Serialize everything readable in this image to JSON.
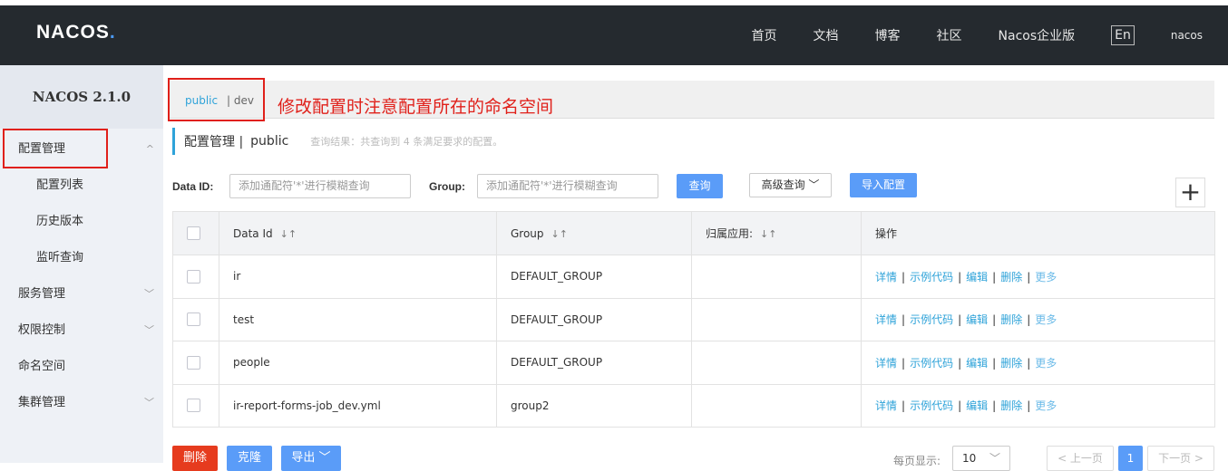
{
  "header": {
    "logo": "NACOS",
    "logo_dot": ".",
    "nav": [
      "首页",
      "文档",
      "博客",
      "社区",
      "Nacos企业版"
    ],
    "lang": "En",
    "user": "nacos"
  },
  "sidebar": {
    "version": "NACOS 2.1.0",
    "items": [
      {
        "label": "配置管理",
        "arrow": "^"
      },
      {
        "label": "配置列表"
      },
      {
        "label": "历史版本"
      },
      {
        "label": "监听查询"
      },
      {
        "label": "服务管理",
        "arrow": "﹀"
      },
      {
        "label": "权限控制",
        "arrow": "﹀"
      },
      {
        "label": "命名空间"
      },
      {
        "label": "集群管理",
        "arrow": "﹀"
      }
    ]
  },
  "namespace": {
    "public": "public",
    "dev": "| dev"
  },
  "annotation": "修改配置时注意配置所在的命名空间",
  "title": {
    "main": "配置管理 |",
    "ns": "public",
    "result": "查询结果：共查询到 4 条满足要求的配置。"
  },
  "filters": {
    "dataid_label": "Data ID:",
    "dataid_placeholder": "添加通配符'*'进行模糊查询",
    "group_label": "Group:",
    "group_placeholder": "添加通配符'*'进行模糊查询",
    "query": "查询",
    "advanced": "高级查询 ﹀",
    "import": "导入配置",
    "plus": "+"
  },
  "table": {
    "headers": [
      "Data Id",
      "Group",
      "归属应用:",
      "操作"
    ],
    "sort_icon": "↓↑",
    "rows": [
      {
        "dataid": "ir",
        "group": "DEFAULT_GROUP",
        "app": ""
      },
      {
        "dataid": "test",
        "group": "DEFAULT_GROUP",
        "app": ""
      },
      {
        "dataid": "people",
        "group": "DEFAULT_GROUP",
        "app": ""
      },
      {
        "dataid": "ir-report-forms-job_dev.yml",
        "group": "group2",
        "app": ""
      }
    ],
    "ops": {
      "detail": "详情",
      "sample": "示例代码",
      "edit": "编辑",
      "delete": "删除",
      "more": "更多",
      "sep": "|"
    }
  },
  "bottom": {
    "delete": "删除",
    "clone": "克隆",
    "export": "导出 ﹀",
    "per_page_label": "每页显示:",
    "per_page": "10",
    "prev": "< 上一页",
    "page": "1",
    "next": "下一页 >"
  },
  "colors": {
    "accent": "#5a9cf8",
    "link": "#2fa3d9",
    "danger": "#e0201a",
    "header_bg": "#252a2f"
  }
}
